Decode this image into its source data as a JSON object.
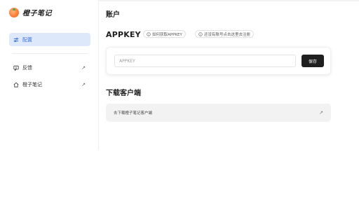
{
  "app": {
    "name": "橙子笔记"
  },
  "sidebar": {
    "active": {
      "label": "配置",
      "icon": "sliders-icon"
    },
    "items": [
      {
        "label": "反馈",
        "icon": "feedback-icon",
        "arrow": "↗"
      },
      {
        "label": "橙子笔记",
        "icon": "home-icon",
        "arrow": "↗"
      }
    ]
  },
  "header": {
    "title": "账户"
  },
  "appkey": {
    "title": "APPKEY",
    "help_link": "如何获取APPKEY",
    "no_account_link": "还没有账号点击这里去注册",
    "input_placeholder": "APPKEY",
    "input_value": "",
    "save_label": "保存"
  },
  "download": {
    "title": "下载客户端",
    "link_text": "去下载橙子笔记客户端",
    "arrow": "↗"
  },
  "colors": {
    "accent": "#3a6fd8",
    "active_bg": "#dde9fb",
    "button": "#1f1f1f",
    "brand": "#ff7a33"
  }
}
